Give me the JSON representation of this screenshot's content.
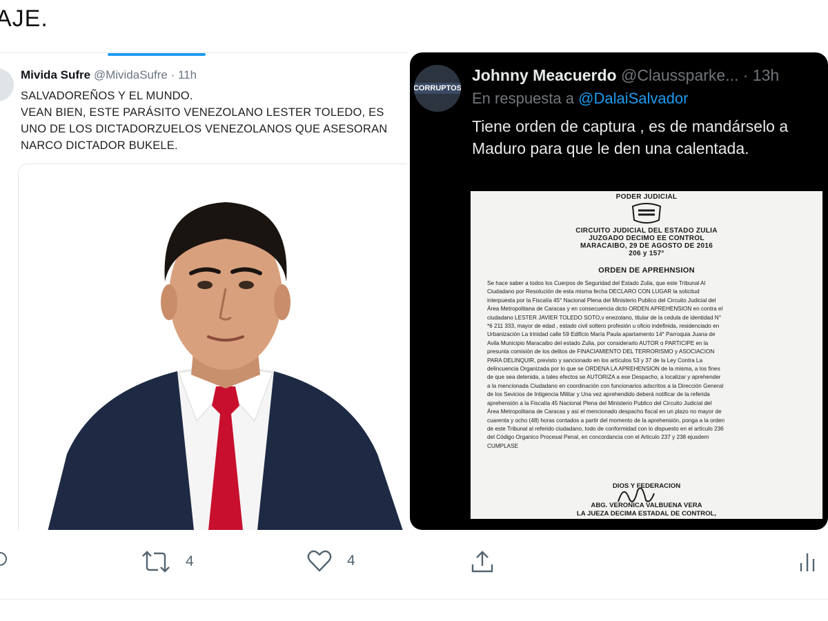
{
  "header": {
    "partial_text": "AJE."
  },
  "left_tweet": {
    "author_name": "Mivida Sufre",
    "author_handle": "@MividaSufre",
    "time": "· 11h",
    "text_lines": [
      "SALVADOREÑOS Y EL MUNDO.",
      "VEAN BIEN, ESTE PARÁSITO VENEZOLANO LESTER TOLEDO, ES",
      "UNO DE LOS DICTADORZUELOS VENEZOLANOS QUE ASESORAN",
      "NARCO DICTADOR BUKELE."
    ]
  },
  "right_tweet": {
    "author_name": "Johnny Meacuerdo",
    "author_handle": "@Claussparke...",
    "time": "· 13h",
    "avatar_label": "CORRUPTOS",
    "reply_prefix": "En respuesta a",
    "reply_mention": "@DalaiSalvador",
    "text_lines": [
      "Tiene orden de captura , es de mandárselo a",
      "Maduro para que le den una calentada."
    ]
  },
  "document": {
    "header_lines": [
      "PODER JUDICIAL",
      "CIRCUITO JUDICIAL DEL ESTADO ZULIA",
      "JUZGADO DECIMO EE CONTROL",
      "MARACAIBO, 29 DE AGOSTO DE 2016",
      "206 y 157°"
    ],
    "title": "ORDEN DE APREHNSION",
    "body_lines": [
      "Se hace saber a todos los  Cuerpos de Seguridad del Estado Zulia, que este  Tribunal Al",
      "Ciudadano por Resolución de esta misma fecha DECLARO CON LUGAR la solicitud",
      "interpuesta por la Fiscalía 45° Nacional Plena del Ministerio Publico  del Circuito Judicial del",
      "Área Metropolitana de Caracas y en consecuencia dicto ORDEN APREHENSION en contra el",
      "ciudadano LESTER JAVIER TOLEDO  SOTO,v enezolano, titular de la cedula de identidad N°",
      "*6 211 333,  mayor de edad , estado civil soltero profesión u oficio indefinida, residenciado en",
      "Urbanización La trinidad calle 59 Edificio María Paula apartamento 14° Parroquia Juana de",
      "Avila Municipio Maracaibo del estado Zulia, por considerarlo AUTOR o PARTICIPE en la",
      "presunta comisión de los delitos de  FINACIAMIENTO DEL TERRORISMO y ASOCIACION",
      "PARA DELINQUIR, previsto y sancionado en los artículos 53 y 37 de la Ley Contra La",
      "delincuencia Organizada  por lo que se ORDENA LA APREHENSION de la misma, a los fines",
      "de que sea detenida, a tales efectos se AUTORIZA a ese Despacho, a localizar y aprehender",
      "a la mencionada Ciudadano en coordinación con funcionarios adscritos a la Dirección General",
      "de los Sevicios de Intigencia Militar y Una vez aprehendido deberá notificar de la referida",
      "aprehensión a la Fiscalía 45 Nacional Plena del Ministerio Publico  del Circuito Judicial del",
      "Área Metropolitana de Caracas y así el mencionado despacho fiscal en un plazo no mayor de",
      "cuarenta y ocho (48) horas contados a partir del momento de la aprehensión, ponga a la orden",
      "de este Tribunal al  referido ciudadano, todo de conformidad con lo dispuesto en el artículo 236",
      "del Código Organico Procesal Penal, en concordancia con el Articulo 237 y 238  ejusdem",
      "CUMPLASE"
    ],
    "signature_lines": [
      "DIOS Y FEDERACION",
      "ABG. VERONICA VALBUENA VERA",
      "LA JUEZA DECIMA ESTADAL DE CONTROL,"
    ]
  },
  "actions": {
    "retweet_count": "4",
    "like_count": "4"
  },
  "colors": {
    "accent_blue": "#1d9bf0",
    "dark_bg": "#000000",
    "muted_text": "#71767b",
    "tie_red": "#c8102e",
    "suit_navy": "#1e2a44"
  }
}
